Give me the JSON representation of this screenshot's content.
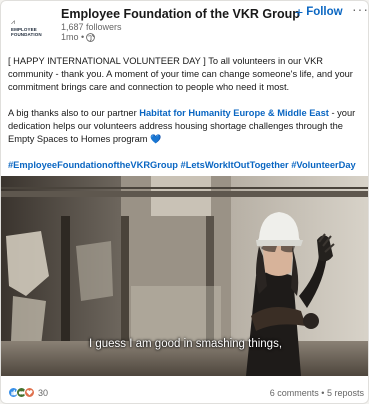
{
  "post": {
    "author": {
      "name": "Employee Foundation of the VKR Group",
      "followers": "1,687 followers",
      "time": "1mo •",
      "logo_line1": "EMPLOYEE",
      "logo_line2": "FOUNDATION"
    },
    "follow_label": "Follow",
    "follow_plus": "+",
    "more_label": "···",
    "paragraph1": "[ HAPPY INTERNATIONAL VOLUNTEER DAY ] To all volunteers in our VKR community - thank you. A moment of your time can change someone's life, and your commitment brings care and connection to people who need it most.",
    "paragraph2_start": "A big thanks also to our partner ",
    "paragraph2_link": "Habitat for Humanity Europe & Middle East",
    "paragraph2_end": " - your dedication helps our volunteers address housing shortage challenges through the Empty Spaces to Homes program ",
    "heart_glyph": "💙",
    "hashtags": [
      "#EmployeeFoundationoftheVKRGroup",
      "#LetsWorkItOutTogether",
      "#VolunteerDay"
    ],
    "video_caption": "I guess I am good in smashing things,",
    "reaction_count": "30",
    "comments": "6 comments",
    "separator": "•",
    "reposts": "5 reposts"
  },
  "colors": {
    "link": "#0a66c2",
    "like": "#378fe9",
    "celebrate": "#44712e",
    "love": "#df704d"
  },
  "icons": {
    "globe": "globe-icon",
    "like": "like-reaction-icon",
    "celebrate": "celebrate-reaction-icon",
    "love": "love-reaction-icon",
    "heart": "blue-heart-emoji"
  }
}
